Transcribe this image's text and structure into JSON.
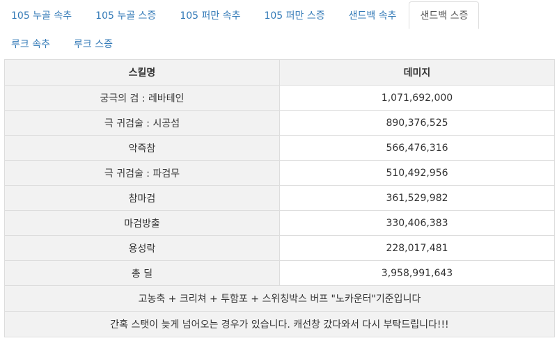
{
  "tabs": [
    {
      "label": "105 누골 속추",
      "active": false
    },
    {
      "label": "105 누골 스증",
      "active": false
    },
    {
      "label": "105 퍼만 속추",
      "active": false
    },
    {
      "label": "105 퍼만 스증",
      "active": false
    },
    {
      "label": "샌드백 속추",
      "active": false
    },
    {
      "label": "샌드백 스증",
      "active": true
    },
    {
      "label": "루크 속추",
      "active": false
    },
    {
      "label": "루크 스증",
      "active": false
    }
  ],
  "table": {
    "headers": {
      "skill": "스킬명",
      "damage": "데미지"
    },
    "rows": [
      {
        "skill": "궁극의 검 : 레바테인",
        "damage": "1,071,692,000"
      },
      {
        "skill": "극 귀검술 : 시공섬",
        "damage": "890,376,525"
      },
      {
        "skill": "악즉참",
        "damage": "566,476,316"
      },
      {
        "skill": "극 귀검술 : 파검무",
        "damage": "510,492,956"
      },
      {
        "skill": "참마검",
        "damage": "361,529,982"
      },
      {
        "skill": "마검방출",
        "damage": "330,406,383"
      },
      {
        "skill": "용성락",
        "damage": "228,017,481"
      },
      {
        "skill": "총 딜",
        "damage": "3,958,991,643"
      }
    ],
    "notes": [
      "고농축 + 크리쳐 + 투함포 + 스위칭박스 버프 \"노카운터\"기준입니다",
      "간혹 스탯이 늦게 넘어오는 경우가 있습니다. 캐선창 갔다와서 다시 부탁드립니다!!!"
    ]
  }
}
